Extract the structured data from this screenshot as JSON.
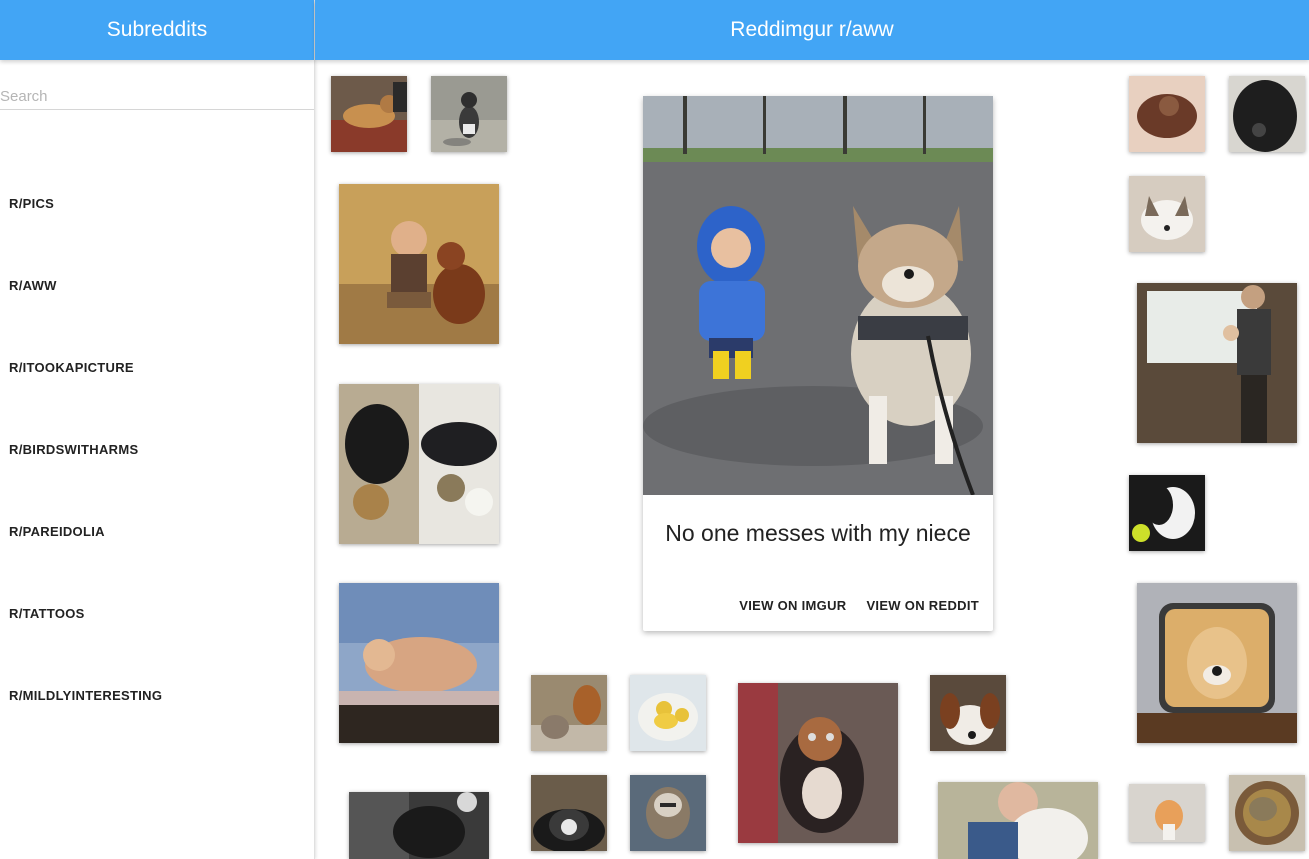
{
  "sidebar": {
    "title": "Subreddits",
    "search_placeholder": "Search",
    "search_value": "",
    "items": [
      {
        "label": "R/PICS"
      },
      {
        "label": "R/AWW"
      },
      {
        "label": "R/ITOOKAPICTURE"
      },
      {
        "label": "R/BIRDSWITHARMS"
      },
      {
        "label": "R/PAREIDOLIA"
      },
      {
        "label": "R/TATTOOS"
      },
      {
        "label": "R/MILDLYINTERESTING"
      }
    ]
  },
  "header": {
    "title": "Reddimgur r/aww"
  },
  "featured": {
    "title": "No one messes with my niece",
    "imgur_label": "VIEW ON IMGUR",
    "reddit_label": "VIEW ON REDDIT"
  },
  "colors": {
    "accent": "#42a5f5",
    "header_text": "#ffffff"
  }
}
